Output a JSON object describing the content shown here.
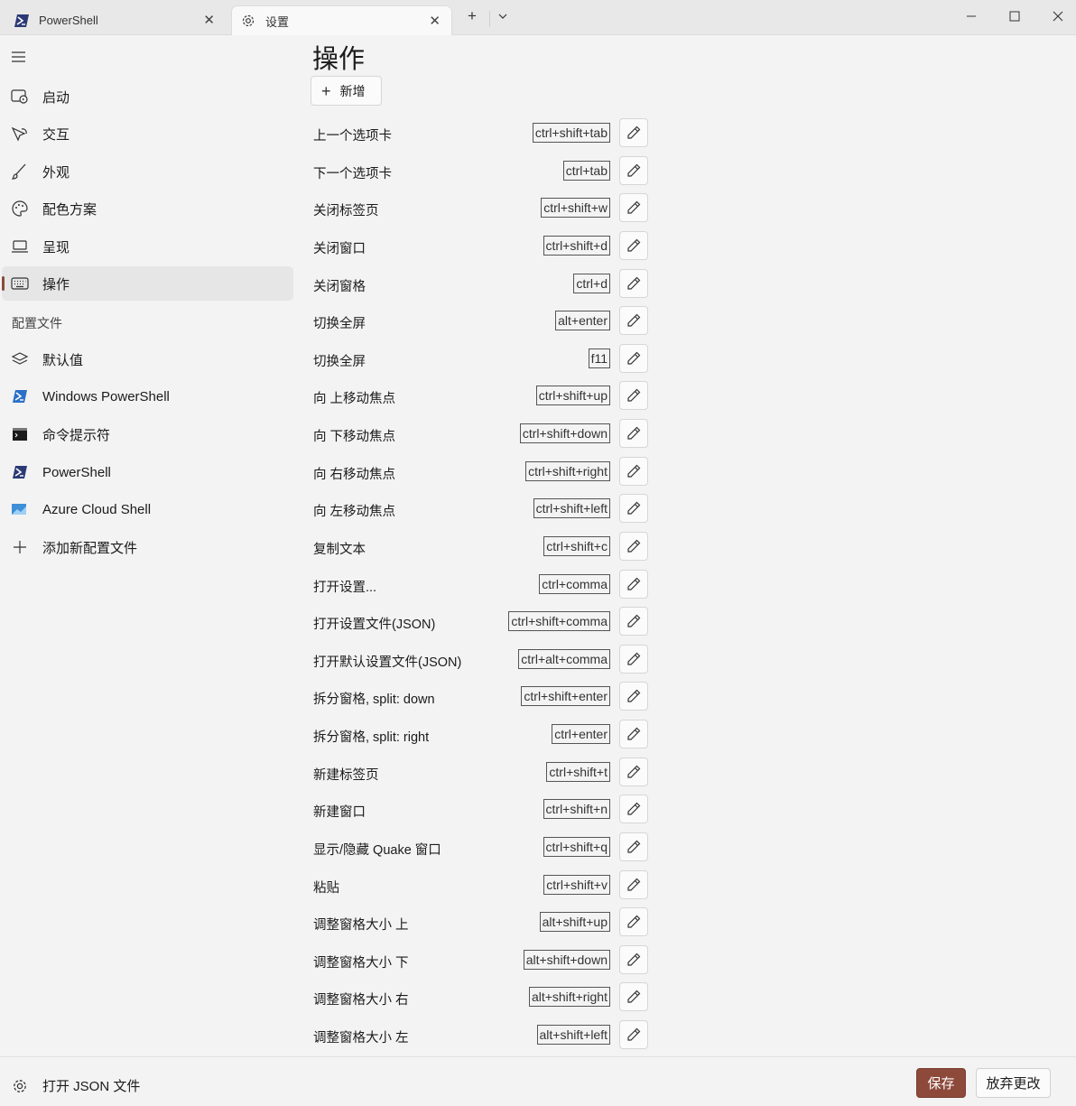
{
  "tabs": [
    {
      "label": "PowerShell",
      "icon": "powershell-icon"
    },
    {
      "label": "设置",
      "icon": "gear-icon"
    }
  ],
  "sidebar": {
    "items": [
      {
        "label": "启动",
        "icon": "startup-icon"
      },
      {
        "label": "交互",
        "icon": "interaction-icon"
      },
      {
        "label": "外观",
        "icon": "brush-icon"
      },
      {
        "label": "配色方案",
        "icon": "palette-icon"
      },
      {
        "label": "呈现",
        "icon": "laptop-icon"
      },
      {
        "label": "操作",
        "icon": "keyboard-icon",
        "selected": true
      }
    ],
    "profiles_header": "配置文件",
    "profiles": [
      {
        "label": "默认值",
        "icon": "layers-icon"
      },
      {
        "label": "Windows PowerShell",
        "icon": "powershell-icon"
      },
      {
        "label": "命令提示符",
        "icon": "cmd-icon"
      },
      {
        "label": "PowerShell",
        "icon": "powershell-icon"
      },
      {
        "label": "Azure Cloud Shell",
        "icon": "azure-icon"
      },
      {
        "label": "添加新配置文件",
        "icon": "plus-icon"
      }
    ]
  },
  "main": {
    "title": "操作",
    "add_label": "新增",
    "actions": [
      {
        "name": "上一个选项卡",
        "keys": "ctrl+shift+tab"
      },
      {
        "name": "下一个选项卡",
        "keys": "ctrl+tab"
      },
      {
        "name": "关闭标签页",
        "keys": "ctrl+shift+w"
      },
      {
        "name": "关闭窗口",
        "keys": "ctrl+shift+d"
      },
      {
        "name": "关闭窗格",
        "keys": "ctrl+d"
      },
      {
        "name": "切换全屏",
        "keys": "alt+enter"
      },
      {
        "name": "切换全屏",
        "keys": "f11"
      },
      {
        "name": "向 上移动焦点",
        "keys": "ctrl+shift+up"
      },
      {
        "name": "向 下移动焦点",
        "keys": "ctrl+shift+down"
      },
      {
        "name": "向 右移动焦点",
        "keys": "ctrl+shift+right"
      },
      {
        "name": "向 左移动焦点",
        "keys": "ctrl+shift+left"
      },
      {
        "name": "复制文本",
        "keys": "ctrl+shift+c"
      },
      {
        "name": "打开设置...",
        "keys": "ctrl+comma"
      },
      {
        "name": "打开设置文件(JSON)",
        "keys": "ctrl+shift+comma"
      },
      {
        "name": "打开默认设置文件(JSON)",
        "keys": "ctrl+alt+comma"
      },
      {
        "name": "拆分窗格, split: down",
        "keys": "ctrl+shift+enter"
      },
      {
        "name": "拆分窗格, split: right",
        "keys": "ctrl+enter"
      },
      {
        "name": "新建标签页",
        "keys": "ctrl+shift+t"
      },
      {
        "name": "新建窗口",
        "keys": "ctrl+shift+n"
      },
      {
        "name": "显示/隐藏 Quake 窗口",
        "keys": "ctrl+shift+q"
      },
      {
        "name": "粘贴",
        "keys": "ctrl+shift+v"
      },
      {
        "name": "调整窗格大小 上",
        "keys": "alt+shift+up"
      },
      {
        "name": "调整窗格大小 下",
        "keys": "alt+shift+down"
      },
      {
        "name": "调整窗格大小 右",
        "keys": "alt+shift+right"
      },
      {
        "name": "调整窗格大小 左",
        "keys": "alt+shift+left"
      }
    ]
  },
  "footer": {
    "open_json_label": "打开 JSON 文件",
    "save_label": "保存",
    "discard_label": "放弃更改"
  },
  "colors": {
    "accent": "#8d4a3b",
    "background": "#f3f3f3"
  }
}
